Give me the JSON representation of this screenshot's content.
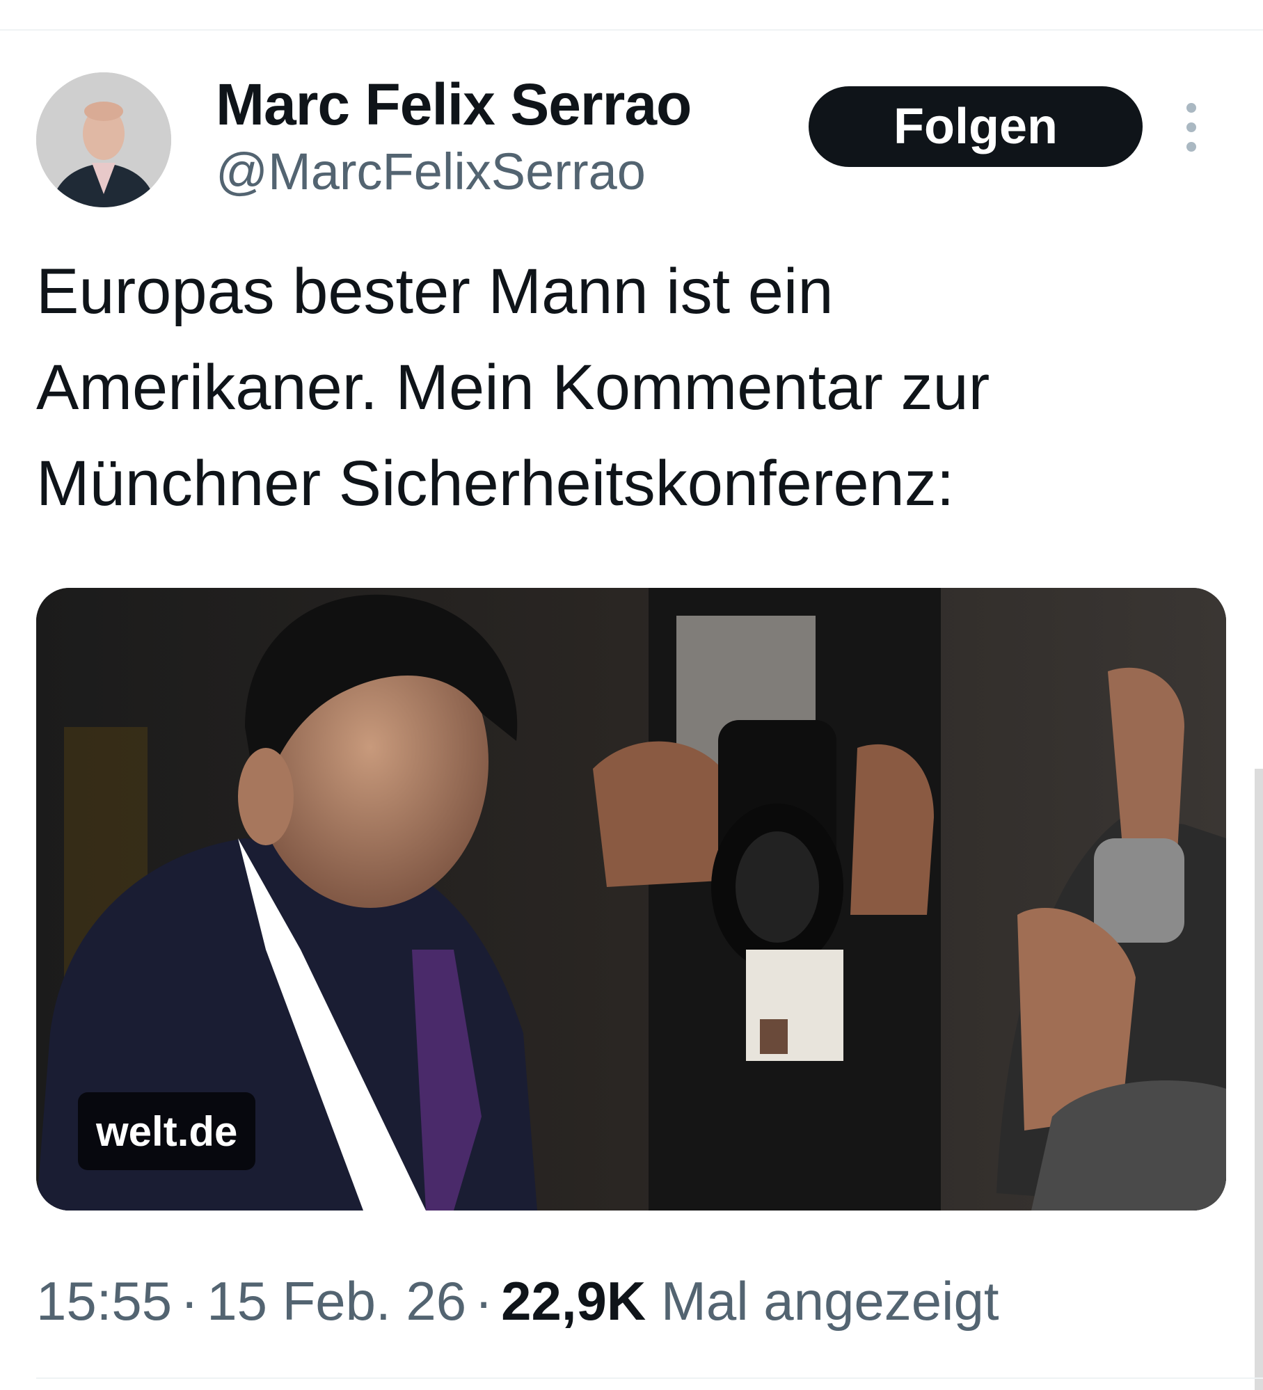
{
  "author": {
    "display_name": "Marc Felix Serrao",
    "handle": "@MarcFelixSerrao"
  },
  "actions": {
    "follow_label": "Folgen",
    "more_icon": "more-vertical-icon"
  },
  "tweet": {
    "text_lines": [
      "Europas bester Mann ist ein",
      "Amerikaner. Mein Kommentar zur",
      "Münchner Sicherheitskonferenz:"
    ]
  },
  "media": {
    "link_domain": "welt.de"
  },
  "meta": {
    "time": "15:55",
    "separator": "·",
    "date": "15 Feb. 26",
    "views_count": "22,9K",
    "views_label": "Mal angezeigt"
  },
  "colors": {
    "text_primary": "#0f1419",
    "text_secondary": "#536471",
    "button_bg": "#0f1419",
    "button_text": "#ffffff"
  }
}
